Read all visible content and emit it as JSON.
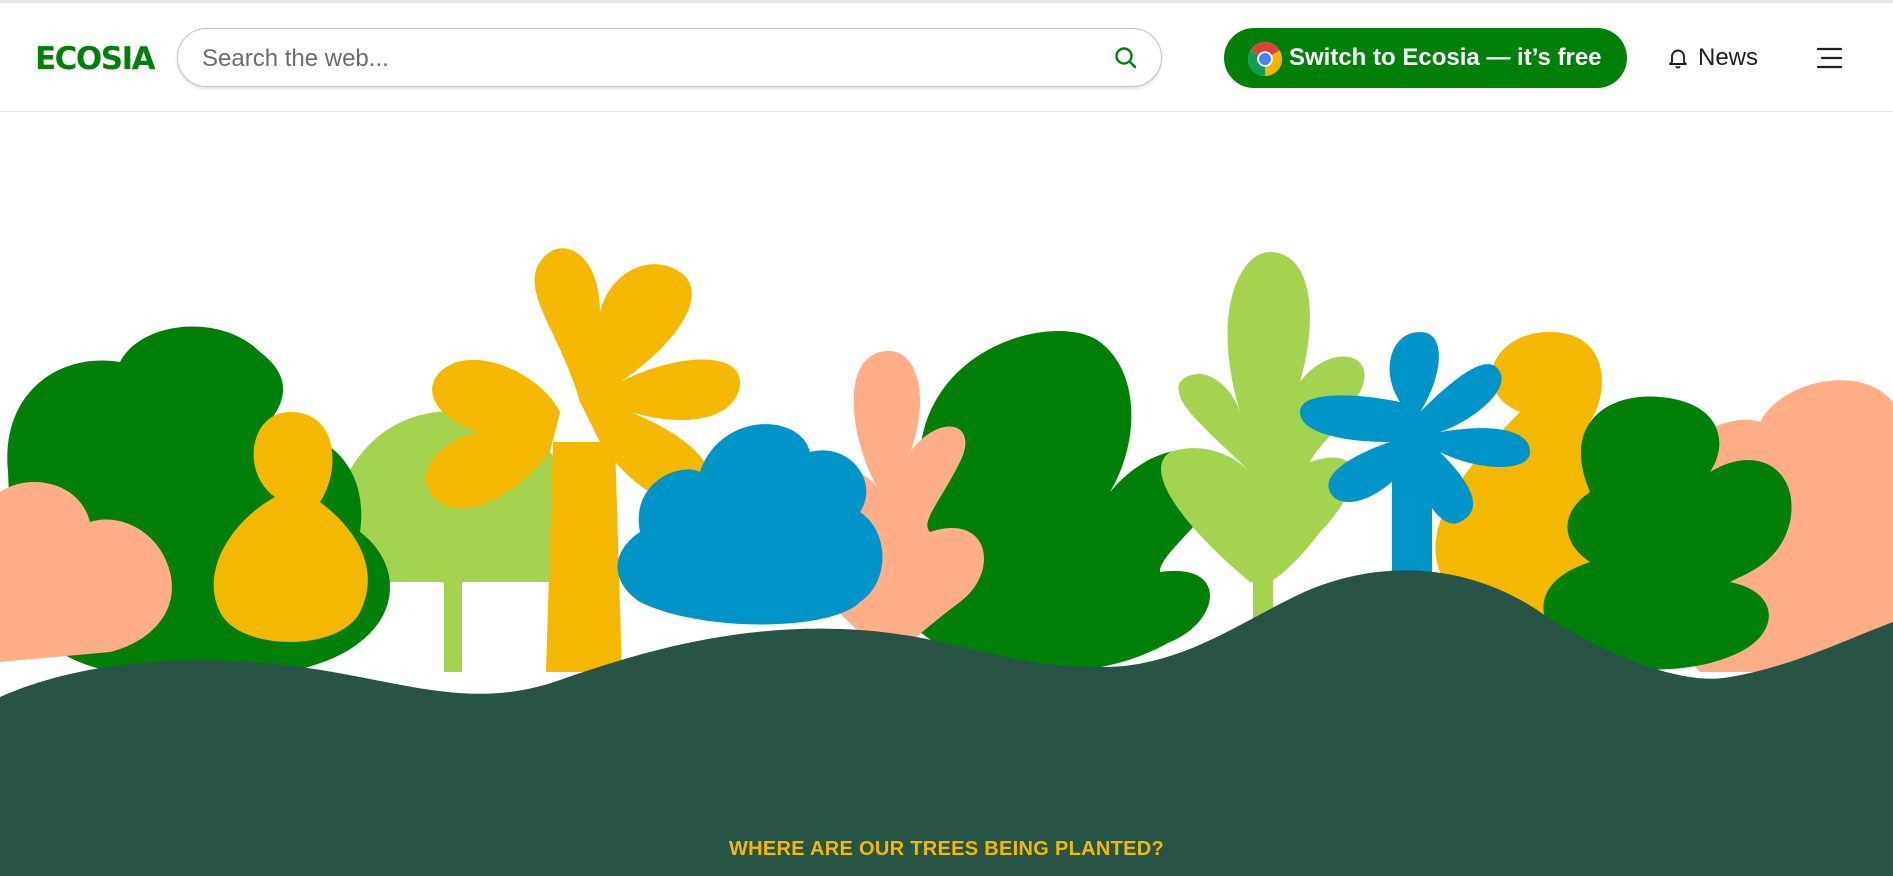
{
  "header": {
    "logo_text": "ECOSIA",
    "search": {
      "placeholder": "Search the web...",
      "value": ""
    },
    "cta_label": "Switch to Ecosia — it’s free",
    "news_label": "News"
  },
  "hero": {
    "section_heading": "WHERE ARE OUR TREES BEING PLANTED?"
  },
  "icons": [
    "search-icon",
    "chrome-icon",
    "bell-icon",
    "hamburger-menu-icon"
  ],
  "colors": {
    "brand_green": "#008009",
    "dark_green": "#008009",
    "light_green": "#a3d34f",
    "yellow": "#f5b800",
    "blue": "#0094c8",
    "peach": "#ffae87",
    "hill": "#285446",
    "heading_yellow": "#f5b800"
  }
}
